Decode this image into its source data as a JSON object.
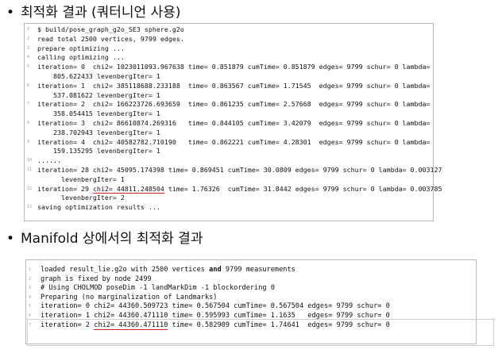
{
  "heading1": {
    "bullet": "•",
    "text": "최적화 결과 (쿼터니언 사용)"
  },
  "heading2": {
    "bullet": "•",
    "text": "Manifold 상에서의 최적화 결과"
  },
  "block1": {
    "lines": [
      {
        "n": "1",
        "text": "$ build/pose_graph_g2o_SE3 sphere.g2o"
      },
      {
        "n": "2",
        "text": "read total 2500 vertices, 9799 edges."
      },
      {
        "n": "3",
        "text": "prepare optimizing ..."
      },
      {
        "n": "4",
        "text": "calling optimizing ..."
      },
      {
        "n": "5",
        "text": "iteration= 0  chi2= 1023011093.967638 time= 0.851879 cumTime= 0.851879 edges= 9799 schur= 0 lambda="
      },
      {
        "n": "",
        "text": "    805.622433 levenbergIter= 1"
      },
      {
        "n": "6",
        "text": "iteration= 1  chi2= 385118688.233188  time= 0.863567 cumTime= 1.71545  edges= 9799 schur= 0 lambda="
      },
      {
        "n": "",
        "text": "    537.081622 levenbergIter= 1"
      },
      {
        "n": "7",
        "text": "iteration= 2  chi2= 166223726.693659  time= 0.861235 cumTime= 2.57668  edges= 9799 schur= 0 lambda="
      },
      {
        "n": "",
        "text": "    358.054415 levenbergIter= 1"
      },
      {
        "n": "8",
        "text": "iteration= 3  chi2= 86610874.269316   time= 0.844105 cumTime= 3.42079  edges= 9799 schur= 0 lambda="
      },
      {
        "n": "",
        "text": "    238.702943 levenbergIter= 1"
      },
      {
        "n": "9",
        "text": "iteration= 4  chi2= 40582782.710190   time= 0.862221 cumTime= 4.28301  edges= 9799 schur= 0 lambda="
      },
      {
        "n": "",
        "text": "    159.135295 levenbergIter= 1"
      },
      {
        "n": "10",
        "text": "......"
      },
      {
        "n": "11",
        "text": "iteration= 28 chi2= 45095.174398 time= 0.869451 cumTime= 30.0809 edges= 9799 schur= 0 lambda= 0.003127"
      },
      {
        "n": "",
        "text": "      levenbergIter= 1"
      },
      {
        "n": "12",
        "pre": "iteration= 29 ",
        "mark": "chi2= 44811.248504",
        "post": " time= 1.76326  cumTime= 31.8442 edges= 9799 schur= 0 lambda= 0.003785"
      },
      {
        "n": "",
        "text": "      levenbergIter= 2"
      },
      {
        "n": "13",
        "text": "saving optimization results ..."
      }
    ]
  },
  "block2": {
    "lines": [
      {
        "n": "1",
        "pre": "loaded result_lie.g2o with 2500 vertices ",
        "bold": "and",
        "post": " 9799 measurements"
      },
      {
        "n": "2",
        "text": "graph is fixed by node 2499"
      },
      {
        "n": "3",
        "text": "# Using CHOLMOD poseDim -1 landMarkDim -1 blockordering 0"
      },
      {
        "n": "4",
        "text": "Preparing (no marginalization of Landmarks)"
      },
      {
        "n": "5",
        "text": "iteration= 0 chi2= 44360.509723 time= 0.567504 cumTime= 0.567504 edges= 9799 schur= 0"
      },
      {
        "n": "6",
        "text": "iteration= 1 chi2= 44360.471110 time= 0.595993 cumTime= 1.1635   edges= 9799 schur= 0"
      },
      {
        "n": "7",
        "pre": "iteration= 2 ",
        "mark": "chi2= 44360.471110",
        "post": " time= 0.582909 cumTime= 1.74641  edges= 9799 schur= 0"
      }
    ]
  },
  "colors": {
    "underline": "#d02020",
    "border": "#b8b8b8",
    "line_number": "#9a9a9a"
  }
}
